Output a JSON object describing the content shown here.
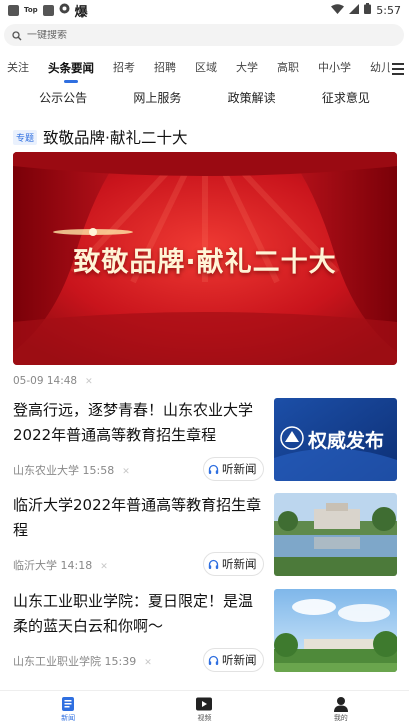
{
  "status_bar": {
    "tiny_label": "Top",
    "brand_char": "爆",
    "time": "5:57"
  },
  "search": {
    "placeholder": "一键搜索"
  },
  "category_tabs": [
    {
      "label": "关注",
      "active": false
    },
    {
      "label": "头条要闻",
      "active": true
    },
    {
      "label": "招考",
      "active": false
    },
    {
      "label": "招聘",
      "active": false
    },
    {
      "label": "区域",
      "active": false
    },
    {
      "label": "大学",
      "active": false
    },
    {
      "label": "高职",
      "active": false
    },
    {
      "label": "中小学",
      "active": false
    },
    {
      "label": "幼儿园",
      "active": false
    }
  ],
  "sub_tabs": [
    "公示公告",
    "网上服务",
    "政策解读",
    "征求意见"
  ],
  "topic": {
    "badge": "专题",
    "title": "致敬品牌·献礼二十大"
  },
  "banner": {
    "text": "致敬品牌·献礼二十大",
    "time": "05-09 14:48"
  },
  "news": [
    {
      "title": "登高行远，逐梦青春！山东农业大学2022年普通高等教育招生章程",
      "source": "山东农业大学",
      "time": "15:58",
      "listen_label": "听新闻",
      "thumb_text": "权威发布"
    },
    {
      "title": "临沂大学2022年普通高等教育招生章程",
      "source": "临沂大学",
      "time": "14:18",
      "listen_label": "听新闻"
    },
    {
      "title": "山东工业职业学院：夏日限定！是温柔的蓝天白云和你啊～",
      "source": "山东工业职业学院",
      "time": "15:39",
      "listen_label": "听新闻"
    }
  ],
  "bottom_nav": [
    {
      "label": "新闻",
      "active": true
    },
    {
      "label": "视频",
      "active": false
    },
    {
      "label": "我的",
      "active": false
    }
  ],
  "colors": {
    "accent": "#2f6fe0",
    "banner_red": "#c9141c"
  }
}
